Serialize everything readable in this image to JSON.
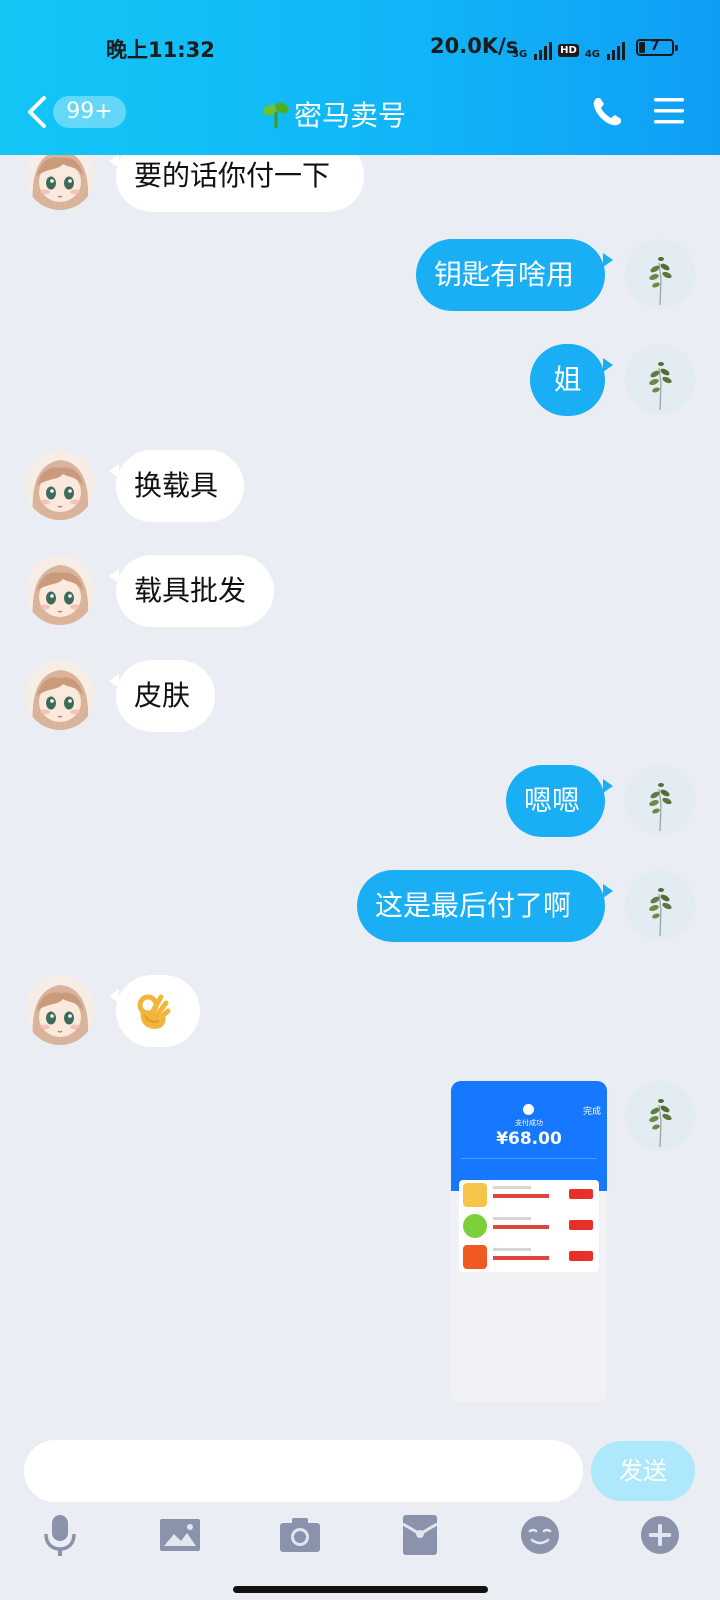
{
  "status_bar": {
    "time": "晚上11:32",
    "net_speed": "20.0K/s",
    "network_a": "3G",
    "network_b": "4G",
    "hd_label": "HD",
    "battery": "7"
  },
  "header": {
    "unread_count": "99+",
    "title": "密马卖号",
    "accent_color": "#10b6f7"
  },
  "messages": [
    {
      "side": "in",
      "text": "要的话你付一下"
    },
    {
      "side": "out",
      "text": "钥匙有啥用"
    },
    {
      "side": "out",
      "text": "姐"
    },
    {
      "side": "in",
      "text": "换载具"
    },
    {
      "side": "in",
      "text": "载具批发"
    },
    {
      "side": "in",
      "text": "皮肤"
    },
    {
      "side": "out",
      "text": "嗯嗯"
    },
    {
      "side": "out",
      "text": "这是最后付了啊"
    },
    {
      "side": "in",
      "emoji": "ok-hand-icon"
    },
    {
      "side": "out",
      "image": "payment-screenshot"
    }
  ],
  "payment_screenshot": {
    "done_label": "完成",
    "paid_label": "支付成功",
    "amount": "¥68.00"
  },
  "composer": {
    "input_value": "",
    "send_label": "发送"
  },
  "toolbar": [
    "microphone-icon",
    "picture-icon",
    "camera-icon",
    "red-packet-icon",
    "emoji-icon",
    "plus-icon"
  ]
}
